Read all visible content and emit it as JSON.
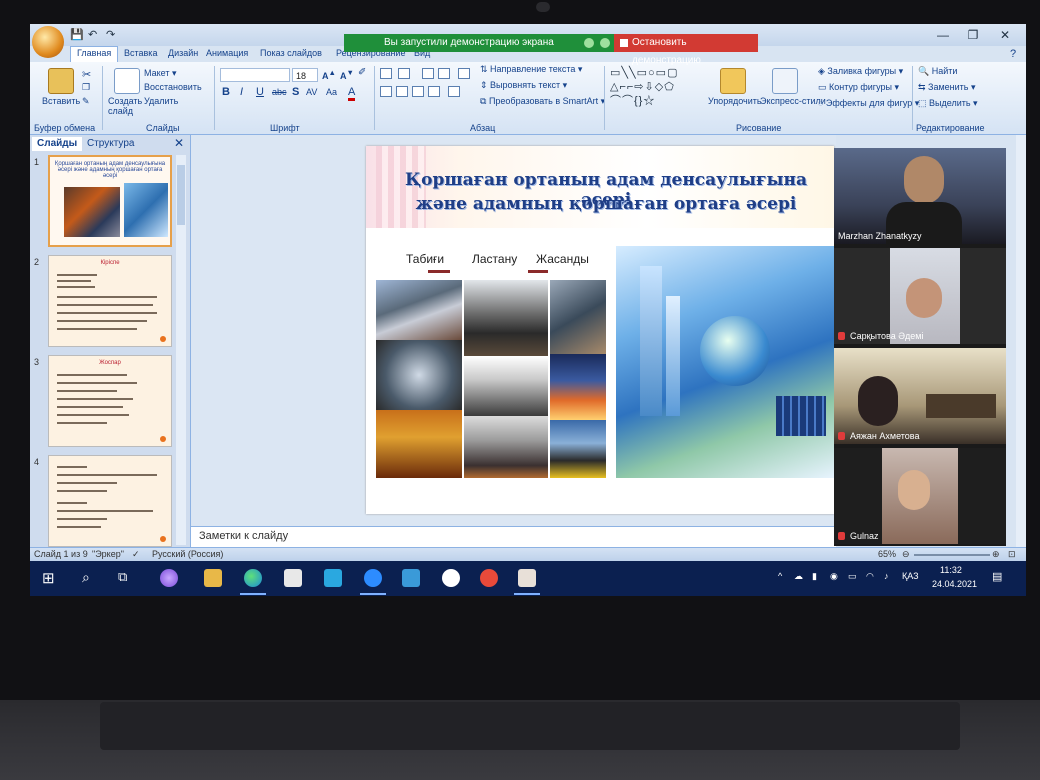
{
  "app": {
    "quick_access": [
      "💾",
      "↶",
      "↷"
    ],
    "window_controls": [
      "—",
      "❐",
      "✕"
    ]
  },
  "zoom_share": {
    "banner": "Вы запустили демонстрацию экрана",
    "stop_button": "Остановить демонстрацию"
  },
  "ribbon": {
    "tabs": [
      "Главная",
      "Вставка",
      "Дизайн",
      "Анимация",
      "Показ слайдов",
      "Рецензирование",
      "Вид"
    ],
    "active_tab": "Главная",
    "clipboard": {
      "paste": "Вставить",
      "label": "Буфер обмена"
    },
    "slides": {
      "new_slide": "Создать слайд",
      "layout": "Макет",
      "reset": "Восстановить",
      "delete": "Удалить",
      "label": "Слайды"
    },
    "font": {
      "name": "",
      "size": "18",
      "label": "Шрифт",
      "buttons": [
        "B",
        "I",
        "U",
        "abc",
        "S",
        "AV",
        "Aa",
        "A"
      ]
    },
    "paragraph": {
      "text_direction": "Направление текста",
      "align_text": "Выровнять текст",
      "smartart": "Преобразовать в SmartArt",
      "label": "Абзац"
    },
    "drawing": {
      "arrange": "Упорядочить",
      "quick_styles": "Экспресс-стили",
      "fill": "Заливка фигуры",
      "outline": "Контур фигуры",
      "effects": "Эффекты для фигур",
      "label": "Рисование"
    },
    "editing": {
      "find": "Найти",
      "replace": "Заменить",
      "select": "Выделить",
      "label": "Редактирование"
    }
  },
  "left_pane": {
    "tabs": [
      "Слайды",
      "Структура"
    ],
    "close": "✕",
    "thumbnails": [
      {
        "num": "1",
        "title": "Қоршаған ортаның адам денсаулығына әсері және адамның қоршаған ортаға әсері"
      },
      {
        "num": "2",
        "title": "Кіріспе"
      },
      {
        "num": "3",
        "title": "Жоспар"
      },
      {
        "num": "4",
        "title": ""
      }
    ]
  },
  "slide": {
    "title_line1": "Қоршаған ортаның адам денсаулығына әсері",
    "title_line2": "және  адамның қоршаған ортаға әсері",
    "label_natural": "Табиғи",
    "label_pollution": "Ластану",
    "label_artificial": "Жасанды"
  },
  "notes": {
    "placeholder": "Заметки к слайду"
  },
  "participants": [
    {
      "name": "Marzhan Zhanatkyzy",
      "muted": false
    },
    {
      "name": "Сарқытова Әдемі",
      "muted": true
    },
    {
      "name": "Аяжан Ахметова",
      "muted": true
    },
    {
      "name": "Gulnaz",
      "muted": true
    }
  ],
  "status_bar": {
    "slide_info": "Слайд 1 из 9",
    "theme": "\"Эркер\"",
    "language": "Русский (Россия)",
    "zoom": "65%"
  },
  "taskbar": {
    "language": "ҚАЗ",
    "time": "11:32",
    "date": "24.04.2021"
  },
  "colors": {
    "ribbon_text": "#15428b",
    "share_green": "#1f8f3a",
    "stop_red": "#d23a33",
    "taskbar": "#0b2050",
    "title_blue": "#1f3e86"
  }
}
